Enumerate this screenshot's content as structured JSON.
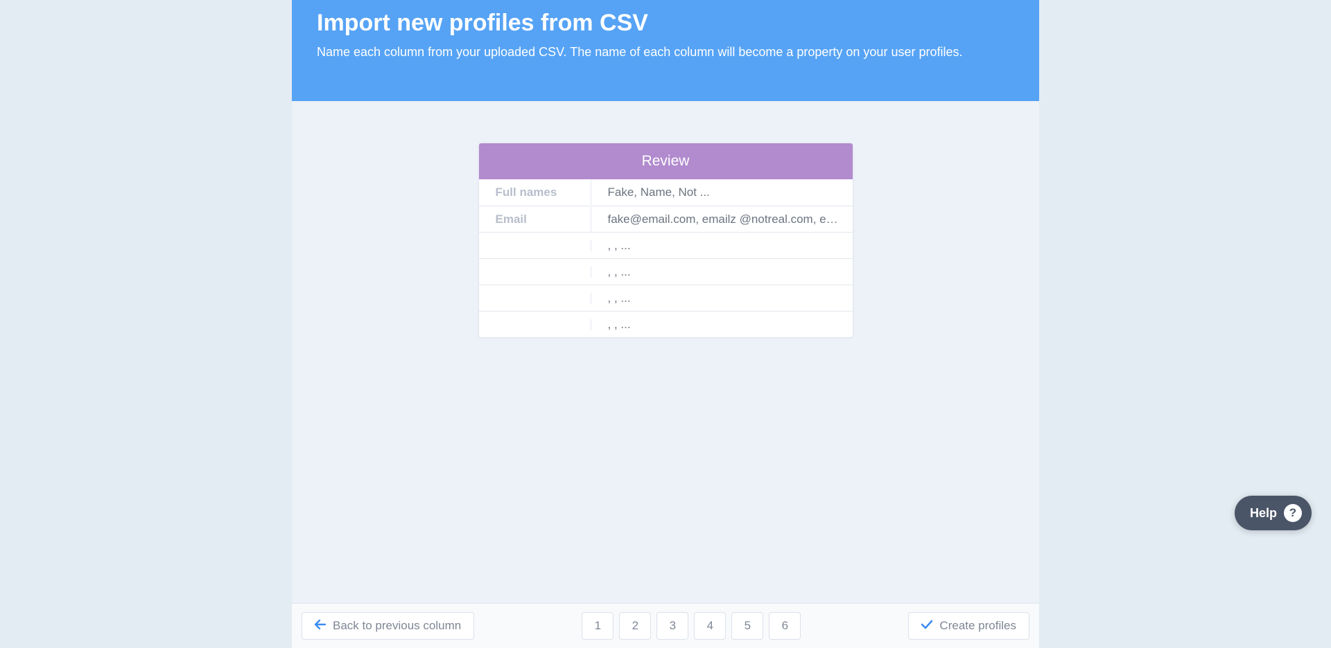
{
  "header": {
    "title": "Import new profiles from CSV",
    "subtitle": "Name each column from your uploaded CSV. The name of each column will become a property on your user profiles."
  },
  "review": {
    "heading": "Review",
    "rows": [
      {
        "label": "Full names",
        "value": "Fake, Name, Not ..."
      },
      {
        "label": "Email",
        "value": "fake@email.com, emailz @notreal.com, em…"
      },
      {
        "label": "",
        "value": ", , ..."
      },
      {
        "label": "",
        "value": ", , ..."
      },
      {
        "label": "",
        "value": ", , ..."
      },
      {
        "label": "",
        "value": ", , ..."
      }
    ]
  },
  "footer": {
    "back_label": "Back to previous column",
    "create_label": "Create profiles",
    "pages": [
      "1",
      "2",
      "3",
      "4",
      "5",
      "6"
    ]
  },
  "help": {
    "label": "Help",
    "icon": "?"
  }
}
